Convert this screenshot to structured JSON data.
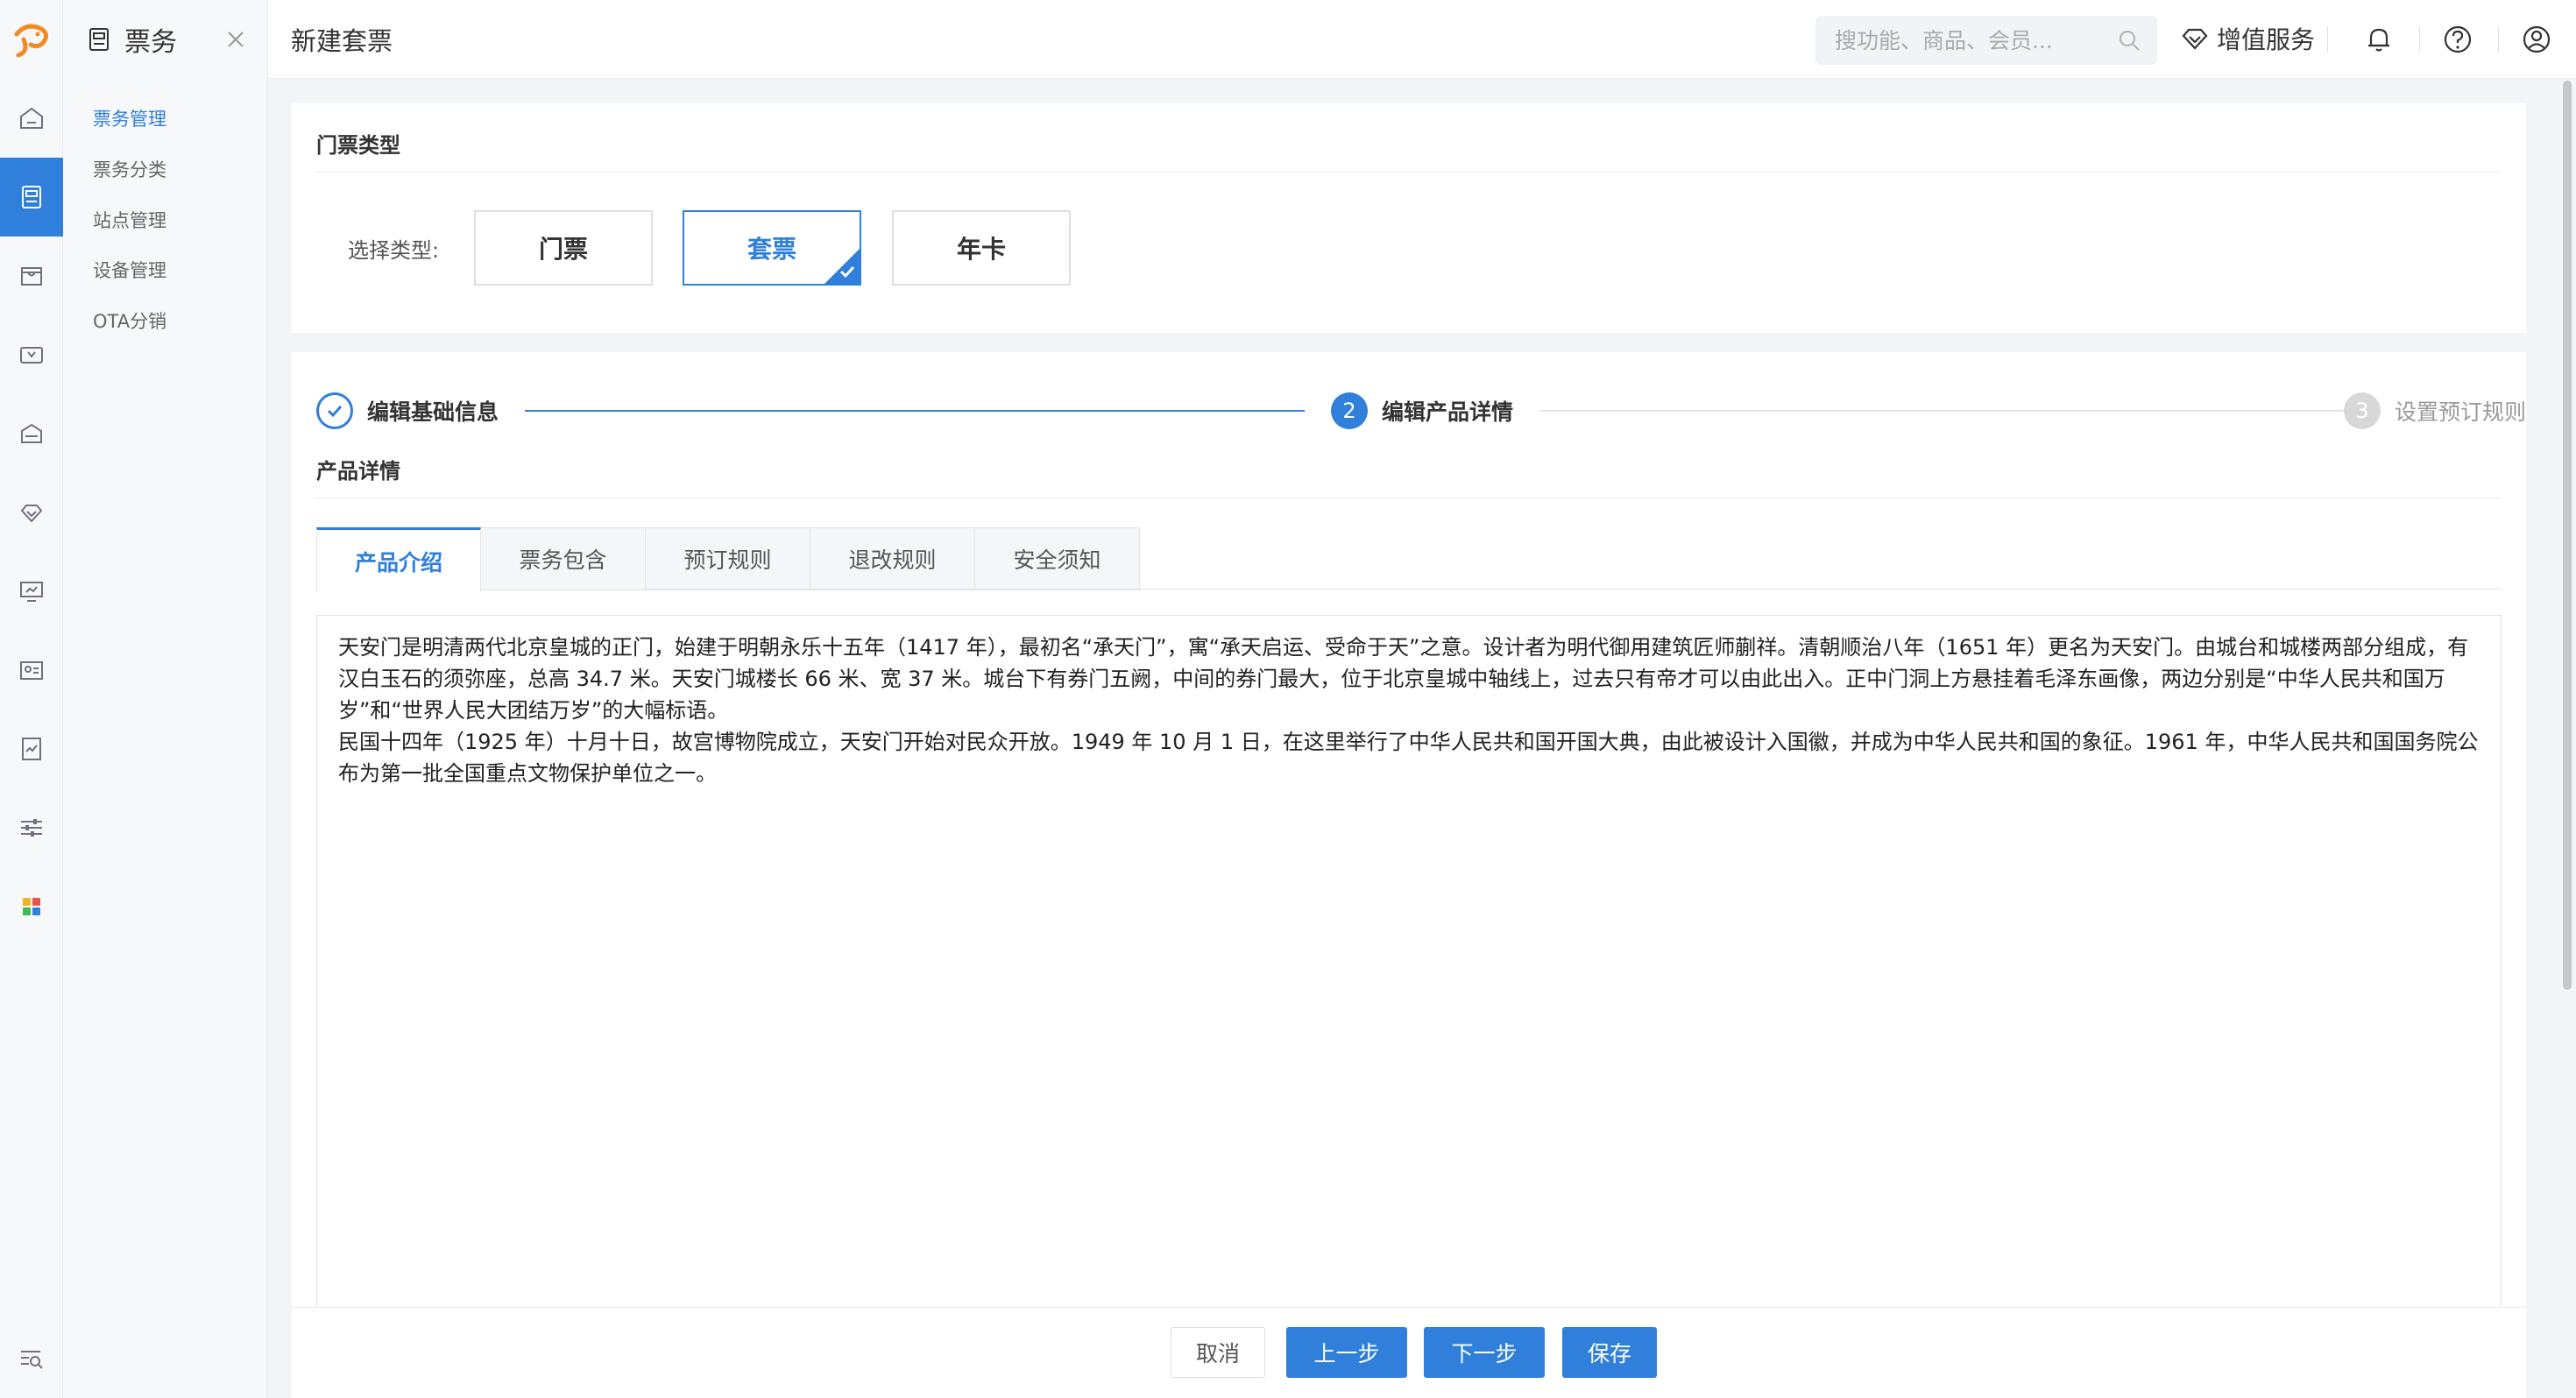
{
  "sidebar": {
    "module_title": "票务",
    "items": [
      {
        "label": "票务管理",
        "active": true
      },
      {
        "label": "票务分类",
        "active": false
      },
      {
        "label": "站点管理",
        "active": false
      },
      {
        "label": "设备管理",
        "active": false
      },
      {
        "label": "OTA分销",
        "active": false
      }
    ]
  },
  "rail": {
    "icons": [
      "home-icon",
      "ticket-icon",
      "store-icon",
      "wallet-icon",
      "bus-icon",
      "diamond-icon",
      "monitor-icon",
      "id-card-icon",
      "report-icon",
      "settings-sliders-icon",
      "apps-icon",
      "search-list-icon"
    ],
    "active_index": 1
  },
  "header": {
    "title": "新建套票",
    "search_placeholder": "搜功能、商品、会员...",
    "vip_label": "增值服务"
  },
  "ticket_type": {
    "section_title": "门票类型",
    "label": "选择类型:",
    "options": [
      "门票",
      "套票",
      "年卡"
    ],
    "selected": "套票"
  },
  "steps": {
    "items": [
      {
        "label": "编辑基础信息",
        "status": "done",
        "number": "1"
      },
      {
        "label": "编辑产品详情",
        "status": "current",
        "number": "2"
      },
      {
        "label": "设置预订规则",
        "status": "todo",
        "number": "3"
      }
    ]
  },
  "details": {
    "section_title": "产品详情",
    "tabs": [
      "产品介绍",
      "票务包含",
      "预订规则",
      "退改规则",
      "安全须知"
    ],
    "active_tab": "产品介绍",
    "paragraphs": [
      "天安门是明清两代北京皇城的正门，始建于明朝永乐十五年（1417 年），最初名“承天门”，寓“承天启运、受命于天”之意。设计者为明代御用建筑匠师蒯祥。清朝顺治八年（1651 年）更名为天安门。由城台和城楼两部分组成，有汉白玉石的须弥座，总高 34.7 米。天安门城楼长 66 米、宽 37 米。城台下有券门五阙，中间的券门最大，位于北京皇城中轴线上，过去只有帝才可以由此出入。正中门洞上方悬挂着毛泽东画像，两边分别是“中华人民共和国万岁”和“世界人民大团结万岁”的大幅标语。",
      "民国十四年（1925 年）十月十日，故宫博物院成立，天安门开始对民众开放。1949 年 10 月 1 日，在这里举行了中华人民共和国开国大典，由此被设计入国徽，并成为中华人民共和国的象征。1961 年，中华人民共和国国务院公布为第一批全国重点文物保护单位之一。"
    ]
  },
  "footer": {
    "cancel": "取消",
    "prev": "上一步",
    "next": "下一步",
    "save": "保存"
  },
  "colors": {
    "accent": "#2f7fdb",
    "logo_orange": "#f08a24"
  }
}
